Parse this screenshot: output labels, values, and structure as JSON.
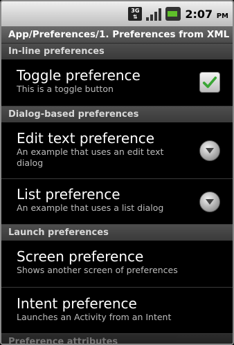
{
  "status_bar": {
    "network_label": "3G",
    "time": "2:07",
    "ampm": "PM",
    "signal_icon": "signal-strength-icon",
    "battery_icon": "battery-charging-icon"
  },
  "title": "App/Preferences/1. Preferences from XML",
  "categories": {
    "inline": "In-line preferences",
    "dialog": "Dialog-based preferences",
    "launch": "Launch preferences",
    "attributes": "Preference attributes"
  },
  "items": {
    "toggle": {
      "title": "Toggle preference",
      "summary": "This is a toggle button",
      "checked": true
    },
    "edit_text": {
      "title": "Edit text preference",
      "summary": "An example that uses an edit text dialog"
    },
    "list": {
      "title": "List preference",
      "summary": "An example that uses a list dialog"
    },
    "screen": {
      "title": "Screen preference",
      "summary": "Shows another screen of preferences"
    },
    "intent": {
      "title": "Intent preference",
      "summary": "Launches an Activity from an Intent"
    }
  },
  "colors": {
    "checkmark": "#3aa635",
    "battery_charge": "#5fbf2a"
  }
}
